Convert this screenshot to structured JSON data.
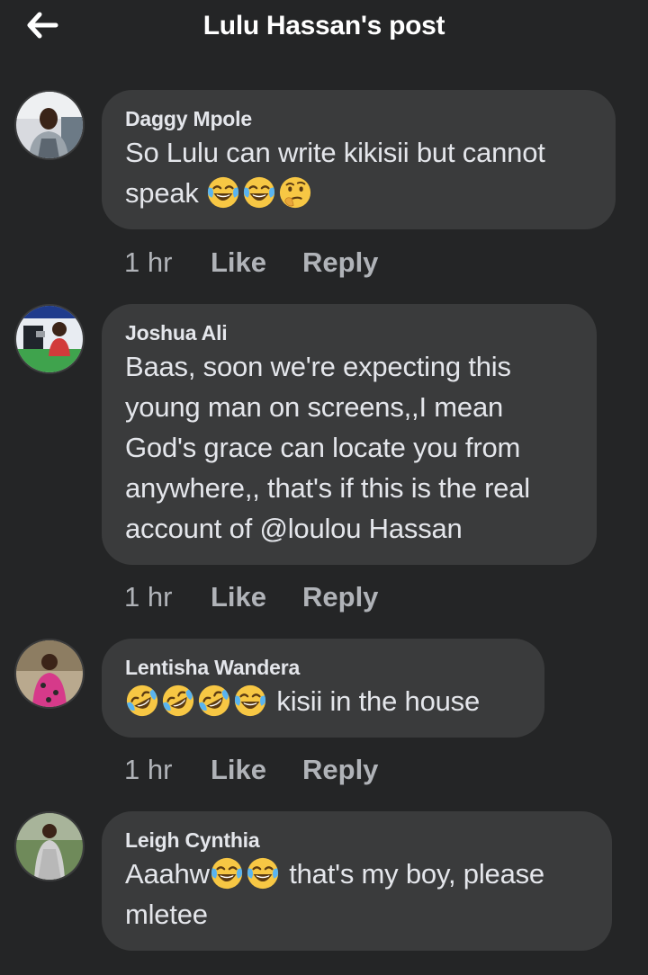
{
  "header": {
    "title": "Lulu Hassan's post"
  },
  "colors": {
    "background": "#242526",
    "bubble": "#3a3b3c",
    "text": "#e4e6eb",
    "secondary_text": "#b0b3b8",
    "emoji_face": "#f7c744"
  },
  "comments": [
    {
      "author": "Daggy Mpole",
      "text_lines": [
        "So Lulu can write kikisii but cannot",
        "speak"
      ],
      "emojis": [
        "joy-emoji",
        "joy-emoji",
        "thinking-emoji"
      ],
      "time": "1 hr",
      "like_label": "Like",
      "reply_label": "Reply"
    },
    {
      "author": "Joshua Ali",
      "text_lines": [
        "Baas, soon we're expecting this",
        "young man on screens,,I mean",
        "God's grace can locate you from",
        "anywhere,, that's if this is the real",
        "account of @loulou Hassan"
      ],
      "time": "1 hr",
      "like_label": "Like",
      "reply_label": "Reply"
    },
    {
      "author": "Lentisha Wandera",
      "text": "kisii in the house",
      "emojis": [
        "rofl-emoji",
        "rofl-emoji",
        "rofl-emoji",
        "joy-emoji"
      ],
      "time": "1 hr",
      "like_label": "Like",
      "reply_label": "Reply"
    },
    {
      "author": "Leigh Cynthia",
      "text_prefix": "Aaahw",
      "text_suffix": "that's my boy, please",
      "text_line2": "mletee",
      "emojis": [
        "joy-emoji",
        "joy-emoji"
      ]
    }
  ]
}
